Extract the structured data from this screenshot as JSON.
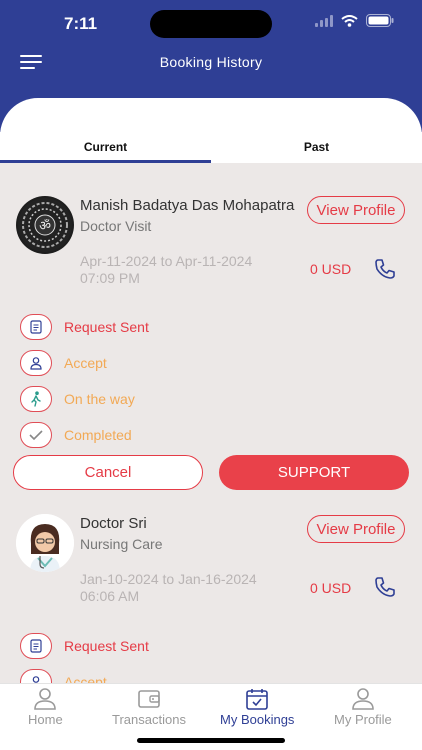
{
  "status_bar": {
    "time": "7:11"
  },
  "header": {
    "title": "Booking History"
  },
  "tabs": [
    {
      "label": "Current",
      "active": true
    },
    {
      "label": "Past",
      "active": false
    }
  ],
  "bookings": [
    {
      "name": "Manish Badatya Das Mohapatra",
      "service": "Doctor Visit",
      "view_profile_label": "View Profile",
      "date_range": "Apr-11-2024 to Apr-11-2024",
      "time": "07:09 PM",
      "amount": "0 USD",
      "statuses": [
        {
          "label": "Request Sent",
          "icon": "document-icon"
        },
        {
          "label": "Accept",
          "icon": "user-icon"
        },
        {
          "label": "On the way",
          "icon": "walking-icon"
        },
        {
          "label": "Completed",
          "icon": "check-icon"
        }
      ],
      "cancel_label": "Cancel",
      "support_label": "SUPPORT"
    },
    {
      "name": "Doctor Sri",
      "service": "Nursing Care",
      "view_profile_label": "View Profile",
      "date_range": "Jan-10-2024 to Jan-16-2024",
      "time": "06:06 AM",
      "amount": "0 USD",
      "statuses": [
        {
          "label": "Request Sent",
          "icon": "document-icon"
        },
        {
          "label": "Accept",
          "icon": "user-icon"
        }
      ]
    }
  ],
  "bottom_nav": [
    {
      "label": "Home",
      "icon": "user-icon",
      "active": false
    },
    {
      "label": "Transactions",
      "icon": "wallet-icon",
      "active": false
    },
    {
      "label": "My Bookings",
      "icon": "calendar-icon",
      "active": true
    },
    {
      "label": "My Profile",
      "icon": "user-icon",
      "active": false
    }
  ],
  "colors": {
    "primary": "#2f3f95",
    "accent": "#e53b46",
    "orange": "#f2a955",
    "background": "#ece8e7"
  }
}
